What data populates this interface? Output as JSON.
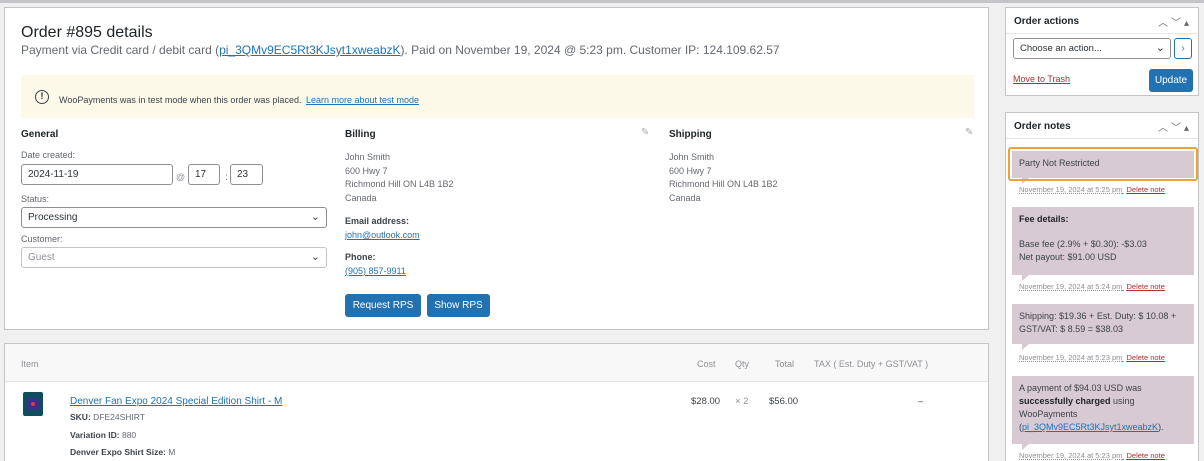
{
  "order": {
    "title": "Order #895 details",
    "subtitle_prefix": "Payment via Credit card / debit card (",
    "payment_id": "pi_3QMv9EC5Rt3KJsyt1xweabzK",
    "subtitle_suffix": "). Paid on November 19, 2024 @ 5:23 pm. Customer IP: 124.109.62.57"
  },
  "notice": {
    "icon": "warning-circle-icon",
    "text": "WooPayments was in test mode when this order was placed.",
    "link": "Learn more about test mode"
  },
  "general": {
    "heading": "General",
    "date_label": "Date created:",
    "date_value": "2024-11-19",
    "at_sign": "@",
    "hour": "17",
    "colon": ":",
    "minute": "23",
    "status_label": "Status:",
    "status_value": "Processing",
    "customer_label": "Customer:",
    "customer_value": "Guest"
  },
  "billing": {
    "heading": "Billing",
    "name": "John Smith",
    "line1": "600 Hwy 7",
    "line2": "Richmond Hill ON L4B 1B2",
    "country": "Canada",
    "email_label": "Email address:",
    "email": "john@outlook.com",
    "phone_label": "Phone:",
    "phone": "(905) 857-9911",
    "btn_request": "Request RPS",
    "btn_show": "Show RPS"
  },
  "shipping": {
    "heading": "Shipping",
    "name": "John Smith",
    "line1": "600 Hwy 7",
    "line2": "Richmond Hill ON L4B 1B2",
    "country": "Canada"
  },
  "items": {
    "headers": {
      "item": "Item",
      "cost": "Cost",
      "qty": "Qty",
      "total": "Total",
      "tax": "TAX ( Est. Duty + GST/VAT )"
    },
    "rows": [
      {
        "name": "Denver Fan Expo 2024 Special Edition Shirt - M",
        "sku_label": "SKU:",
        "sku": "DFE24SHIRT",
        "variation_label": "Variation ID:",
        "variation": "880",
        "size_label": "Denver Expo Shirt Size:",
        "size": "M",
        "cost": "$28.00",
        "qty": "× 2",
        "total": "$56.00",
        "tax": "–"
      }
    ]
  },
  "order_actions": {
    "title": "Order actions",
    "select_value": "Choose an action...",
    "go": "›",
    "trash": "Move to Trash",
    "update": "Update"
  },
  "order_notes": {
    "title": "Order notes",
    "delete_label": "Delete note",
    "notes": [
      {
        "text": "Party Not Restricted",
        "meta": "November 19, 2024 at 5:25 pm"
      },
      {
        "title": "Fee details:",
        "line1": "Base fee (2.9% + $0.30): -$3.03",
        "line2": "Net payout: $91.00 USD",
        "meta": "November 19, 2024 at 5:24 pm"
      },
      {
        "line1": "Shipping: $19.36 + Est. Duty: $ 10.08 +",
        "line2": "GST/VAT: $ 8.59 = $38.03",
        "meta": "November 19, 2024 at 5:23 pm"
      },
      {
        "line1": "A payment of $94.03 USD was",
        "bold": "successfully charged",
        "line2_suffix": " using",
        "line3": "WooPayments",
        "link": "pi_3QMv9EC5Rt3KJsyt1xweabzK",
        "meta": "November 19, 2024 at 5:23 pm"
      }
    ]
  },
  "colors": {
    "accent": "#2271b1",
    "note_bg": "#d7cad2",
    "notice_bg": "#fcf9e8",
    "highlight": "#e8a33a",
    "danger": "#b32d2e"
  }
}
